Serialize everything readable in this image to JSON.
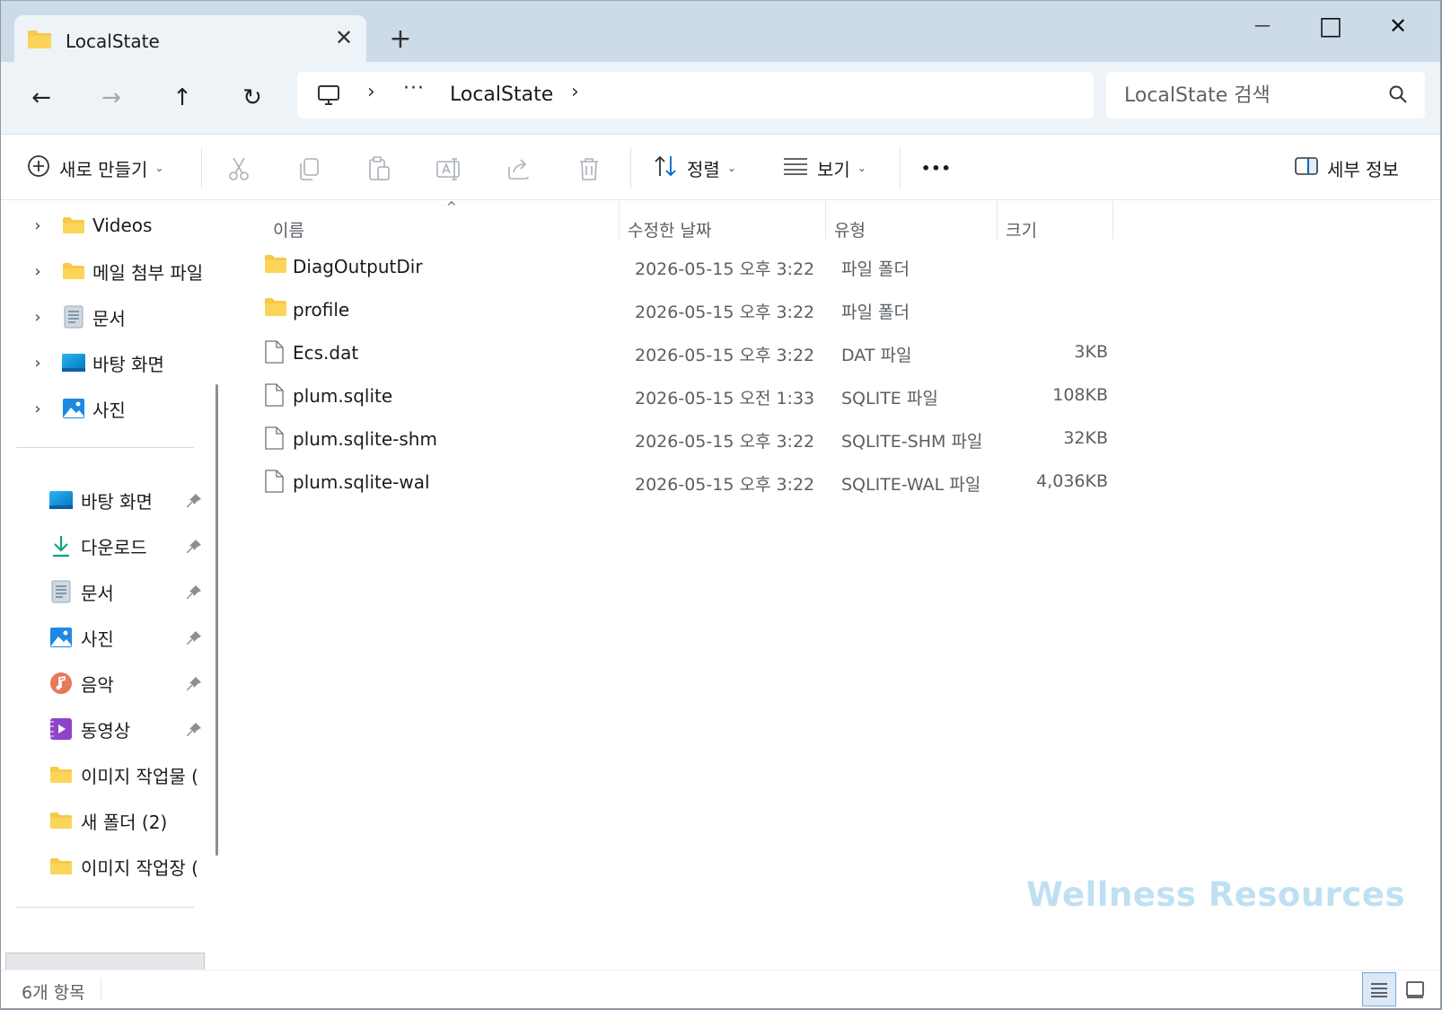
{
  "window": {
    "tab_title": "LocalState",
    "new_tab": "+",
    "minimize": "—",
    "maximize": "□",
    "close": "✕",
    "tab_close": "✕"
  },
  "address": {
    "back": "←",
    "forward": "→",
    "up": "↑",
    "refresh": "↻",
    "crumb_sep": "›",
    "crumb_overflow": "···",
    "current": "LocalState",
    "search_placeholder": "LocalState 검색"
  },
  "toolbar": {
    "new_label": "새로 만들기",
    "sort_label": "정렬",
    "view_label": "보기",
    "more_label": "•••",
    "details_label": "세부 정보",
    "caret": "⌄"
  },
  "sidebar": {
    "tree": [
      {
        "label": "Videos",
        "icon": "folder-icon"
      },
      {
        "label": "메일 첨부 파일",
        "icon": "folder-icon"
      },
      {
        "label": "문서",
        "icon": "document-icon"
      },
      {
        "label": "바탕 화면",
        "icon": "desktop-icon"
      },
      {
        "label": "사진",
        "icon": "pictures-icon"
      }
    ],
    "quick": [
      {
        "label": "바탕 화면",
        "icon": "desktop-icon"
      },
      {
        "label": "다운로드",
        "icon": "download-icon"
      },
      {
        "label": "문서",
        "icon": "document-icon"
      },
      {
        "label": "사진",
        "icon": "pictures-icon"
      },
      {
        "label": "음악",
        "icon": "music-icon"
      },
      {
        "label": "동영상",
        "icon": "video-icon"
      },
      {
        "label": "이미지 작업물 (",
        "icon": "folder-icon"
      },
      {
        "label": "새 폴더 (2)",
        "icon": "folder-icon"
      },
      {
        "label": "이미지 작업장 (",
        "icon": "folder-icon"
      }
    ]
  },
  "columns": {
    "name": "이름",
    "date": "수정한 날짜",
    "type": "유형",
    "size": "크기",
    "sort_indicator": "^"
  },
  "files": [
    {
      "name": "DiagOutputDir",
      "date": "2026-05-15 오후 3:22",
      "type": "파일 폴더",
      "size": "",
      "kind": "folder"
    },
    {
      "name": "profile",
      "date": "2026-05-15 오후 3:22",
      "type": "파일 폴더",
      "size": "",
      "kind": "folder"
    },
    {
      "name": "Ecs.dat",
      "date": "2026-05-15 오후 3:22",
      "type": "DAT 파일",
      "size": "3KB",
      "kind": "file"
    },
    {
      "name": "plum.sqlite",
      "date": "2026-05-15 오전 1:33",
      "type": "SQLITE 파일",
      "size": "108KB",
      "kind": "file"
    },
    {
      "name": "plum.sqlite-shm",
      "date": "2026-05-15 오후 3:22",
      "type": "SQLITE-SHM 파일",
      "size": "32KB",
      "kind": "file"
    },
    {
      "name": "plum.sqlite-wal",
      "date": "2026-05-15 오후 3:22",
      "type": "SQLITE-WAL 파일",
      "size": "4,036KB",
      "kind": "file"
    }
  ],
  "status": {
    "item_count": "6개 항목"
  },
  "watermark": "Wellness Resources",
  "colors": {
    "titlebar": "#cddbe8",
    "addrbar": "#eef3f8",
    "folder": "#f7c948",
    "accent": "#0067c0"
  }
}
